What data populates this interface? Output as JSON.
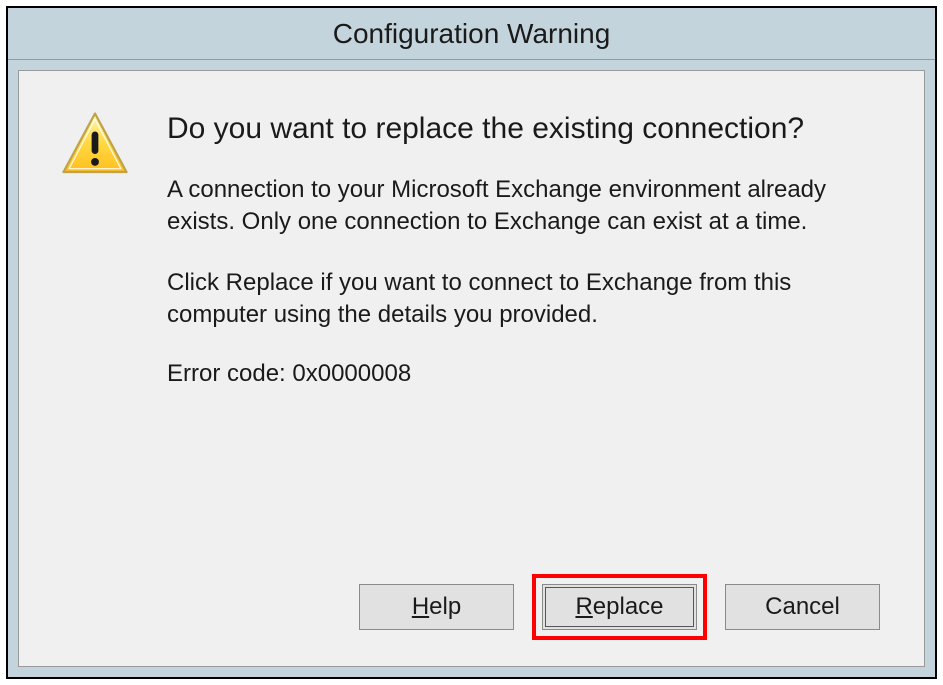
{
  "dialog": {
    "title": "Configuration Warning",
    "heading": "Do you want to replace the existing connection?",
    "paragraph1": "A connection to your Microsoft Exchange environment already exists. Only one connection to Exchange can exist at a time.",
    "paragraph2": "Click Replace if you want to connect to Exchange from this computer using the details you provided.",
    "error_label": "Error code:  0x0000008",
    "buttons": {
      "help": "Help",
      "replace": "Replace",
      "cancel": "Cancel"
    }
  }
}
